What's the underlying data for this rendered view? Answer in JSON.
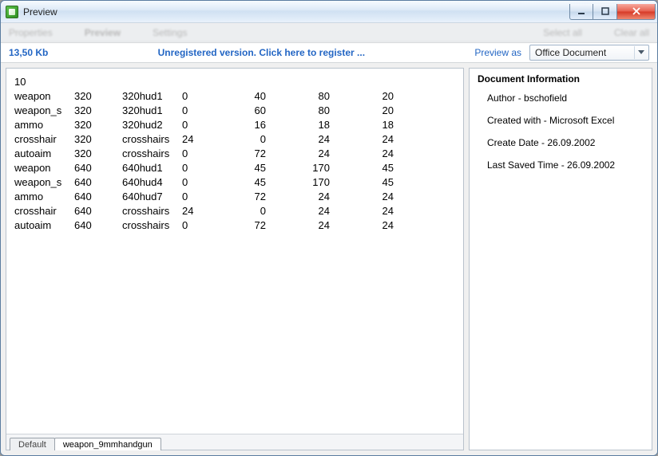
{
  "window": {
    "title": "Preview"
  },
  "header": {
    "filesize": "13,50 Kb",
    "register_text": "Unregistered version. Click here to register ...",
    "preview_as_label": "Preview as",
    "preview_as_value": "Office Document"
  },
  "sheet": {
    "leading": "10",
    "rows": [
      {
        "c0": "weapon",
        "c1": "320",
        "c2": "320hud1",
        "c3": "0",
        "c4": "40",
        "c5": "80",
        "c6": "20"
      },
      {
        "c0": "weapon_s",
        "c1": "320",
        "c2": "320hud1",
        "c3": "0",
        "c4": "60",
        "c5": "80",
        "c6": "20"
      },
      {
        "c0": "ammo",
        "c1": "320",
        "c2": "320hud2",
        "c3": "0",
        "c4": "16",
        "c5": "18",
        "c6": "18"
      },
      {
        "c0": "crosshair",
        "c1": "320",
        "c2": "crosshairs",
        "c3": "24",
        "c4": "0",
        "c5": "24",
        "c6": "24"
      },
      {
        "c0": "autoaim",
        "c1": "320",
        "c2": "crosshairs",
        "c3": "0",
        "c4": "72",
        "c5": "24",
        "c6": "24"
      },
      {
        "c0": "weapon",
        "c1": "640",
        "c2": "640hud1",
        "c3": "0",
        "c4": "45",
        "c5": "170",
        "c6": "45"
      },
      {
        "c0": "weapon_s",
        "c1": "640",
        "c2": "640hud4",
        "c3": "0",
        "c4": "45",
        "c5": "170",
        "c6": "45"
      },
      {
        "c0": "ammo",
        "c1": "640",
        "c2": "640hud7",
        "c3": "0",
        "c4": "72",
        "c5": "24",
        "c6": "24"
      },
      {
        "c0": "crosshair",
        "c1": "640",
        "c2": "crosshairs",
        "c3": "24",
        "c4": "0",
        "c5": "24",
        "c6": "24"
      },
      {
        "c0": "autoaim",
        "c1": "640",
        "c2": "crosshairs",
        "c3": "0",
        "c4": "72",
        "c5": "24",
        "c6": "24"
      }
    ],
    "tabs": [
      "Default",
      "weapon_9mmhandgun"
    ],
    "active_tab": 1
  },
  "info": {
    "heading": "Document Information",
    "items": [
      "Author - bschofield",
      "Created with - Microsoft Excel",
      "Create Date - 26.09.2002",
      "Last Saved Time - 26.09.2002"
    ]
  }
}
